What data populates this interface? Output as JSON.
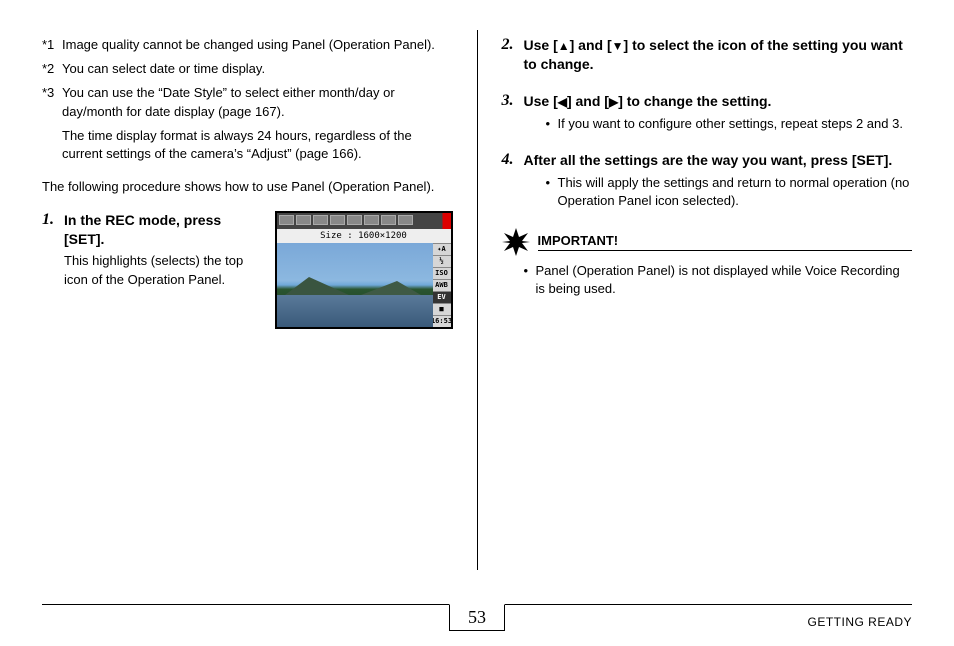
{
  "footnotes": [
    {
      "marker": "*1",
      "text": "Image quality cannot be changed using Panel (Operation Panel)."
    },
    {
      "marker": "*2",
      "text": "You can select date or time display."
    },
    {
      "marker": "*3",
      "text": "You can use the “Date Style” to select either month/day or day/month for date display (page 167)."
    }
  ],
  "footnote_sub": "The time display format is always 24 hours, regardless of the current settings of the camera’s “Adjust” (page 166).",
  "intro": "The following procedure shows how to use Panel (Operation Panel).",
  "step1": {
    "num": "1.",
    "title": "In the REC mode, press [SET].",
    "desc": "This highlights (selects) the top icon of the Operation Panel."
  },
  "camera": {
    "size_label": "Size : 1600×1200",
    "side_icons": [
      "✦A",
      "½",
      "ISO",
      "AWB",
      "EV",
      "■",
      "16:53"
    ]
  },
  "step2": {
    "num": "2.",
    "pre": "Use [",
    "mid": "] and [",
    "post": "] to select the icon of the setting you want to change."
  },
  "step3": {
    "num": "3.",
    "pre": "Use [",
    "mid": "] and [",
    "post": "] to change the setting.",
    "bullet": "If you want to configure other settings, repeat steps 2 and 3."
  },
  "step4": {
    "num": "4.",
    "title": "After all the settings are the way you want, press [SET].",
    "bullet": "This will apply the settings and return to normal operation (no Operation Panel icon selected)."
  },
  "important": {
    "label": "IMPORTANT!",
    "bullet": "Panel (Operation Panel) is not displayed while Voice Recording is being used."
  },
  "page_number": "53",
  "footer_label": "GETTING READY"
}
